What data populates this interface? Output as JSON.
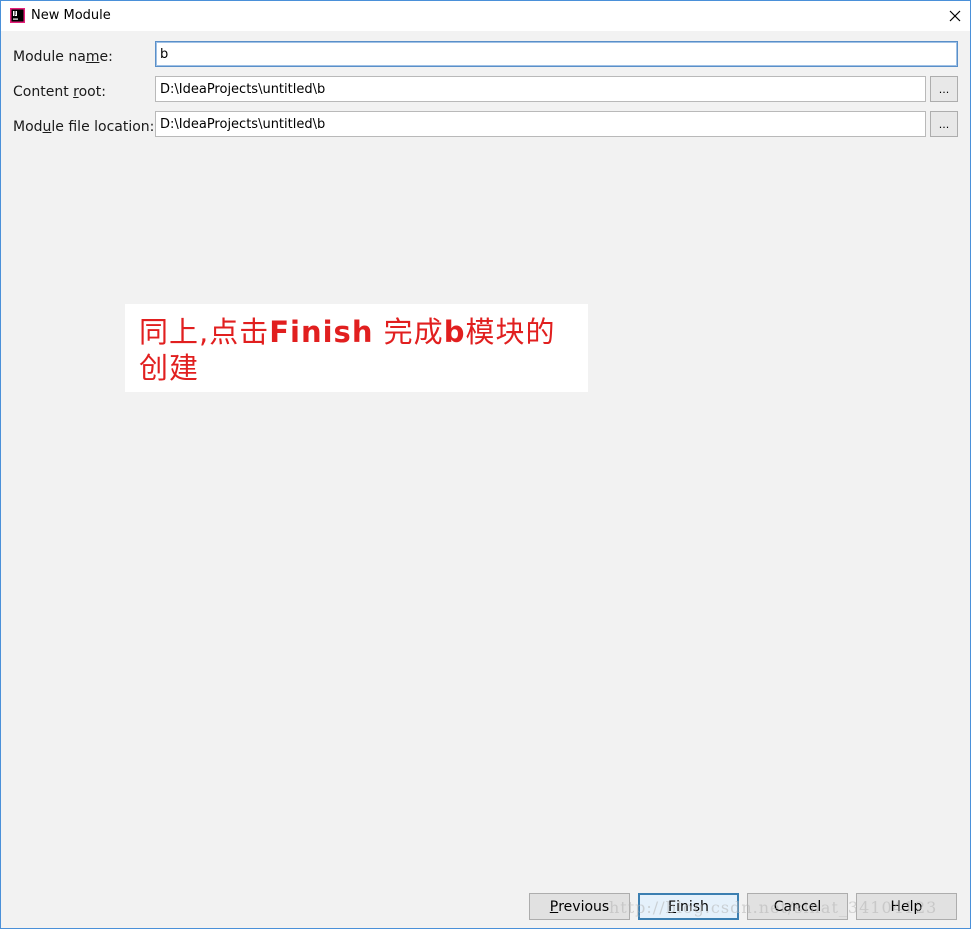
{
  "window": {
    "title": "New Module",
    "close_glyph": "✕"
  },
  "form": {
    "module_name": {
      "label_pre": "Module na",
      "label_mnemonic": "m",
      "label_post": "e:",
      "value": "b"
    },
    "content_root": {
      "label_pre": "Content ",
      "label_mnemonic": "r",
      "label_post": "oot:",
      "value": "D:\\IdeaProjects\\untitled\\b",
      "browse_label": "..."
    },
    "module_file_location": {
      "label_pre": "Mod",
      "label_mnemonic": "u",
      "label_post": "le file location:",
      "value": "D:\\IdeaProjects\\untitled\\b",
      "browse_label": "..."
    }
  },
  "annotation": {
    "line1_pre": "同上,点击",
    "line1_bold": "Finish",
    "line1_mid": " 完成",
    "line1_bold2": "b",
    "line1_post": "模块的",
    "line2": "创建",
    "color": "#e11f1f"
  },
  "buttons": {
    "previous": {
      "mnemonic": "P",
      "rest": "revious"
    },
    "finish": {
      "mnemonic": "F",
      "rest": "inish"
    },
    "cancel": {
      "label": "Cancel"
    },
    "help": {
      "label": "Help"
    }
  },
  "watermark": "http://blog.csdn.net/sinat_34104123",
  "colors": {
    "accent": "#3c7fb1",
    "window_border": "#4a90d9",
    "background": "#f2f2f2"
  }
}
